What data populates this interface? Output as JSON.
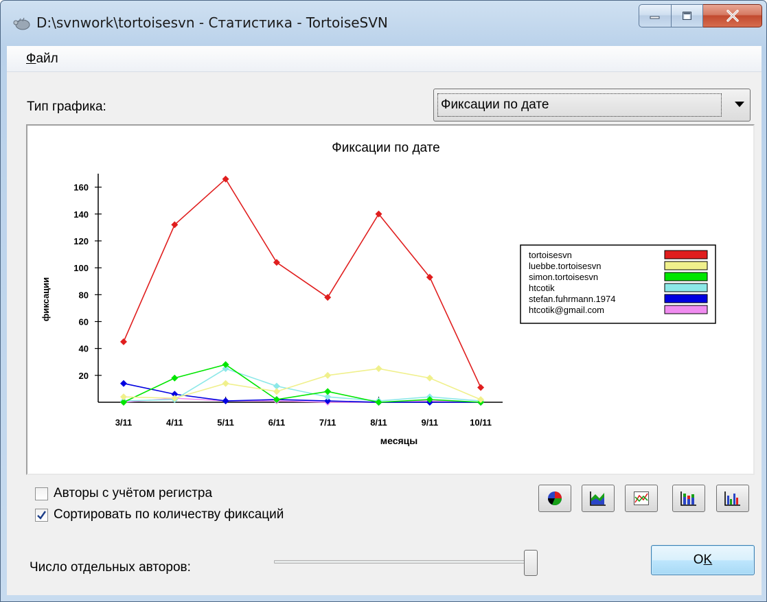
{
  "window": {
    "title": "D:\\svnwork\\tortoisesvn - Статистика - TortoiseSVN"
  },
  "menu": {
    "file_label_accel": "Ф",
    "file_label_rest": "айл"
  },
  "graph_type": {
    "label": "Тип графика:",
    "selected": "Фиксации по дате"
  },
  "chart_data": {
    "type": "line",
    "title": "Фиксации по дате",
    "xlabel": "месяцы",
    "ylabel": "фиксации",
    "categories": [
      "3/11",
      "4/11",
      "5/11",
      "6/11",
      "7/11",
      "8/11",
      "9/11",
      "10/11"
    ],
    "yticks": [
      20,
      40,
      60,
      80,
      100,
      120,
      140,
      160
    ],
    "ylim": [
      0,
      170
    ],
    "legend_position": "right",
    "series": [
      {
        "name": "tortoisesvn",
        "color": "#e01e1e",
        "values": [
          45,
          132,
          166,
          104,
          78,
          140,
          93,
          11
        ]
      },
      {
        "name": "luebbe.tortoisesvn",
        "color": "#f0f08c",
        "values": [
          4,
          3,
          14,
          8,
          20,
          25,
          18,
          2
        ]
      },
      {
        "name": "simon.tortoisesvn",
        "color": "#00e600",
        "values": [
          0,
          18,
          28,
          2,
          8,
          0,
          2,
          0
        ]
      },
      {
        "name": "htcotik",
        "color": "#8ce8e8",
        "values": [
          1,
          2,
          25,
          12,
          4,
          1,
          4,
          1
        ]
      },
      {
        "name": "stefan.fuhrmann.1974",
        "color": "#0000e0",
        "values": [
          14,
          6,
          1,
          2,
          1,
          0,
          0,
          0
        ]
      },
      {
        "name": "htcotik@gmail.com",
        "color": "#f08cf0",
        "values": [
          0,
          3,
          1,
          1,
          0,
          0,
          1,
          0
        ]
      }
    ]
  },
  "options": {
    "case_sensitive_label": "Авторы с учётом регистра",
    "case_sensitive_checked": false,
    "sort_by_commits_label": "Сортировать по количеству фиксаций",
    "sort_by_commits_checked": true
  },
  "authors": {
    "label": "Число отдельных авторов:",
    "slider_fraction": 1.0
  },
  "ok_button": {
    "label_pre": "O",
    "label_accel": "K"
  },
  "colors": {
    "accent": "#3c7fb1"
  }
}
